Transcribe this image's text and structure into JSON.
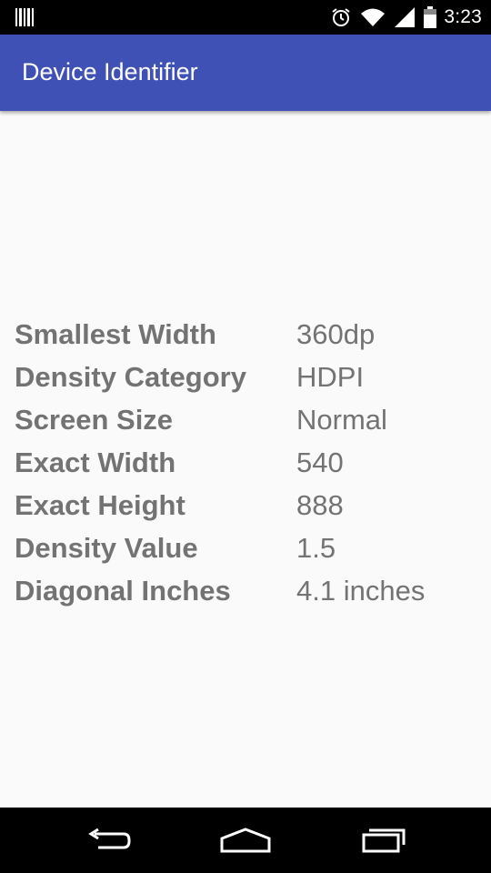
{
  "status_bar": {
    "time": "3:23",
    "icons": [
      "notification-barcode-icon",
      "alarm-icon",
      "wifi-icon",
      "cell-signal-icon",
      "battery-icon"
    ]
  },
  "app_bar": {
    "title": "Device Identifier",
    "color": "#3f51b5"
  },
  "info": {
    "rows": [
      {
        "label": "Smallest Width",
        "value": "360dp"
      },
      {
        "label": "Density Category",
        "value": "HDPI"
      },
      {
        "label": "Screen Size",
        "value": "Normal"
      },
      {
        "label": "Exact Width",
        "value": "540"
      },
      {
        "label": "Exact Height",
        "value": "888"
      },
      {
        "label": "Density Value",
        "value": "1.5"
      },
      {
        "label": "Diagonal Inches",
        "value": "4.1 inches"
      }
    ]
  },
  "nav_bar": {
    "buttons": [
      "back-icon",
      "home-icon",
      "recents-icon"
    ]
  }
}
